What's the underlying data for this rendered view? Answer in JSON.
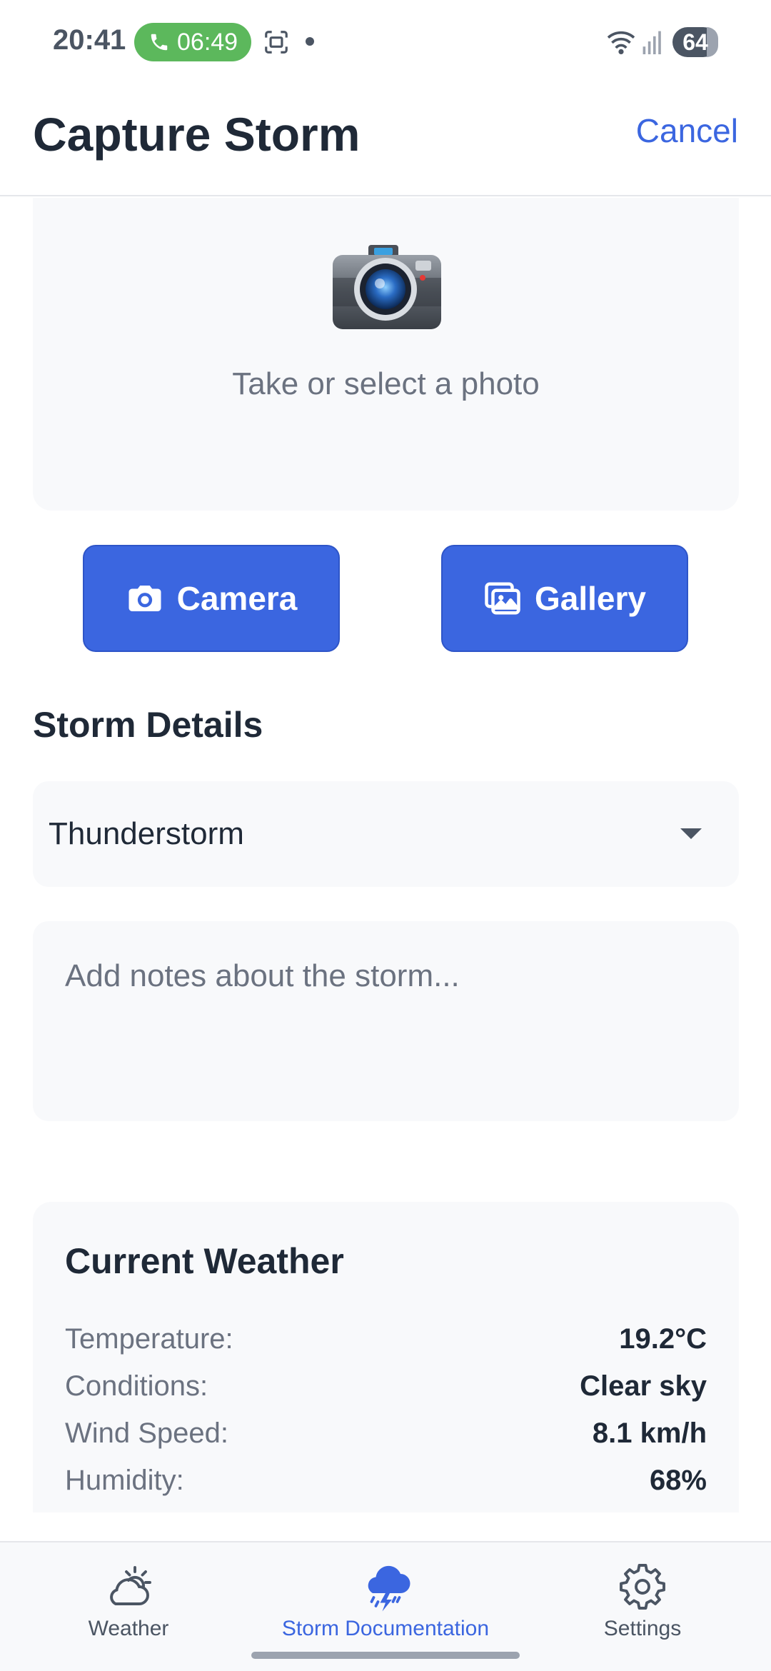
{
  "status_bar": {
    "time": "20:41",
    "call_timer": "06:49",
    "battery": "64",
    "icons": [
      "phone-icon",
      "screenshot-icon",
      "wifi-icon",
      "signal-icon"
    ]
  },
  "header": {
    "title": "Capture Storm",
    "cancel_label": "Cancel"
  },
  "photo": {
    "icon": "camera-illustration",
    "prompt": "Take or select a photo"
  },
  "actions": {
    "camera_label": "Camera",
    "gallery_label": "Gallery"
  },
  "details": {
    "section_title": "Storm Details",
    "storm_type": "Thunderstorm",
    "notes_placeholder": "Add notes about the storm..."
  },
  "weather": {
    "title": "Current Weather",
    "rows": [
      {
        "label": "Temperature:",
        "value": "19.2°C"
      },
      {
        "label": "Conditions:",
        "value": "Clear sky"
      },
      {
        "label": "Wind Speed:",
        "value": "8.1 km/h"
      },
      {
        "label": "Humidity:",
        "value": "68%"
      }
    ]
  },
  "nav": {
    "items": [
      {
        "label": "Weather",
        "icon": "partly-cloudy-icon",
        "active": false
      },
      {
        "label": "Storm Documentation",
        "icon": "storm-cloud-icon",
        "active": true
      },
      {
        "label": "Settings",
        "icon": "gear-icon",
        "active": false
      }
    ]
  },
  "colors": {
    "accent": "#3b66e0",
    "call_green": "#5cb85c",
    "surface": "#f8f9fb",
    "text_primary": "#1f2937",
    "text_secondary": "#6b7280"
  }
}
